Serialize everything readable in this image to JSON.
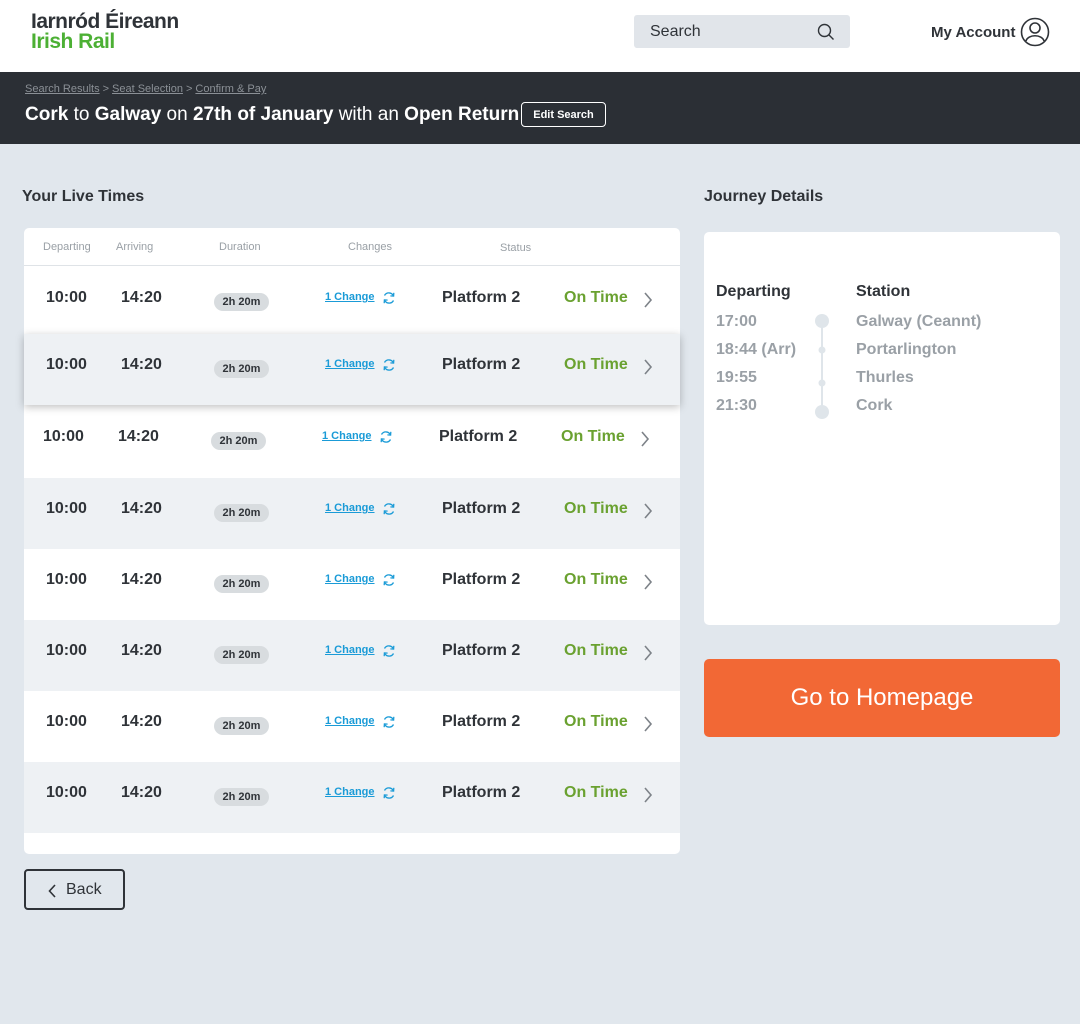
{
  "brand": {
    "line1": "Iarnród Éireann",
    "line2": "Irish Rail"
  },
  "search": {
    "placeholder": "Search"
  },
  "account": {
    "label": "My Account"
  },
  "breadcrumb": [
    "Search Results",
    "Seat Selection",
    "Confirm & Pay"
  ],
  "breadcrumb_sep": ">",
  "route": {
    "origin": "Cork",
    "to": "to",
    "destination": "Galway",
    "on": "on",
    "date": "27th of January",
    "with": "with an",
    "ticket": "Open Return"
  },
  "edit_search_label": "Edit Search",
  "live_times": {
    "title": "Your Live Times",
    "columns": [
      "Departing",
      "Arriving",
      "Duration",
      "Changes",
      "Status"
    ],
    "rows": [
      {
        "departing": "10:00",
        "arriving": "14:20",
        "duration": "2h 20m",
        "changes": "1 Change",
        "platform": "Platform 2",
        "status": "On Time"
      },
      {
        "departing": "10:00",
        "arriving": "14:20",
        "duration": "2h 20m",
        "changes": "1 Change",
        "platform": "Platform 2",
        "status": "On Time"
      },
      {
        "departing": "10:00",
        "arriving": "14:20",
        "duration": "2h 20m",
        "changes": "1 Change",
        "platform": "Platform 2",
        "status": "On Time"
      },
      {
        "departing": "10:00",
        "arriving": "14:20",
        "duration": "2h 20m",
        "changes": "1 Change",
        "platform": "Platform 2",
        "status": "On Time"
      },
      {
        "departing": "10:00",
        "arriving": "14:20",
        "duration": "2h 20m",
        "changes": "1 Change",
        "platform": "Platform 2",
        "status": "On Time"
      },
      {
        "departing": "10:00",
        "arriving": "14:20",
        "duration": "2h 20m",
        "changes": "1 Change",
        "platform": "Platform 2",
        "status": "On Time"
      },
      {
        "departing": "10:00",
        "arriving": "14:20",
        "duration": "2h 20m",
        "changes": "1 Change",
        "platform": "Platform 2",
        "status": "On Time"
      },
      {
        "departing": "10:00",
        "arriving": "14:20",
        "duration": "2h 20m",
        "changes": "1 Change",
        "platform": "Platform 2",
        "status": "On Time"
      }
    ]
  },
  "back_label": "Back",
  "journey": {
    "title": "Journey Details",
    "departing_header": "Departing",
    "station_header": "Station",
    "stops": [
      {
        "time": "17:00",
        "station": "Galway (Ceannt)"
      },
      {
        "time": "18:44 (Arr)",
        "station": "Portarlington"
      },
      {
        "time": "19:55",
        "station": "Thurles"
      },
      {
        "time": "21:30",
        "station": "Cork"
      }
    ]
  },
  "home_label": "Go to Homepage",
  "colors": {
    "brand_green": "#4cb034",
    "status_green": "#6aa130",
    "link_blue": "#1a9bd7",
    "accent_orange": "#f26835",
    "header_dark": "#2b2f35",
    "page_bg": "#e1e7ed"
  },
  "icons": {
    "search": "search-icon",
    "account": "user-circle-icon",
    "change": "refresh-icon",
    "row_chevron": "chevron-right-icon",
    "back_chevron": "chevron-left-icon"
  }
}
